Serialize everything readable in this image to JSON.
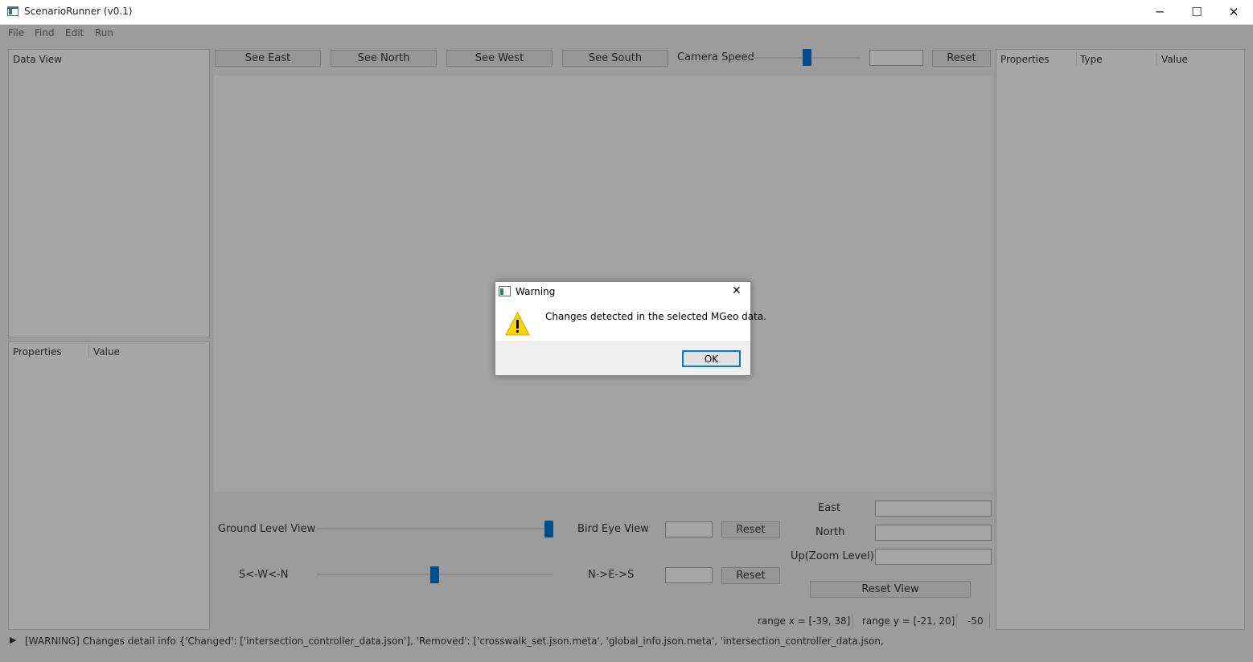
{
  "window": {
    "title": "ScenarioRunner (v0.1)",
    "minimize_glyph": "─",
    "maximize_glyph": "☐",
    "close_glyph": "✕"
  },
  "menu": [
    "File",
    "Find",
    "Edit",
    "Run"
  ],
  "left_panel": {
    "data_view_label": "Data View",
    "properties_header": "Properties",
    "value_header": "Value"
  },
  "toolbar": {
    "see_east": "See East",
    "see_north": "See North",
    "see_west": "See West",
    "see_south": "See South",
    "camera_speed_label": "Camera Speed",
    "camera_speed_value": "",
    "reset": "Reset"
  },
  "view_controls": {
    "ground_level_label": "Ground Level View",
    "bird_eye_label": "Bird Eye View",
    "bird_eye_value": "",
    "reset_1": "Reset",
    "rotation_left_label": "S<-W<-N",
    "rotation_right_label": "N->E->S",
    "rotation_value": "",
    "reset_2": "Reset",
    "east_label": "East",
    "north_label": "North",
    "up_label": "Up(Zoom Level)",
    "east_value": "",
    "north_value": "",
    "up_value": "",
    "reset_view": "Reset View"
  },
  "status": {
    "range_x": "range x = [-39, 38]",
    "range_y": "range y = [-21, 20]",
    "z": "-50"
  },
  "right_panel": {
    "properties_header": "Properties",
    "type_header": "Type",
    "value_header": "Value"
  },
  "log": {
    "expand_glyph": "▶",
    "message": "[WARNING] Changes detail info {'Changed': ['intersection_controller_data.json'], 'Removed': ['crosswalk_set.json.meta', 'global_info.json.meta', 'intersection_controller_data.json,"
  },
  "dialog": {
    "title": "Warning",
    "message": "Changes detected in the selected MGeo data.",
    "ok_label": "OK",
    "close_glyph": "✕",
    "warning_glyph": "!"
  },
  "colors": {
    "accent": "#0078d7",
    "warning_yellow": "#ffd700"
  }
}
